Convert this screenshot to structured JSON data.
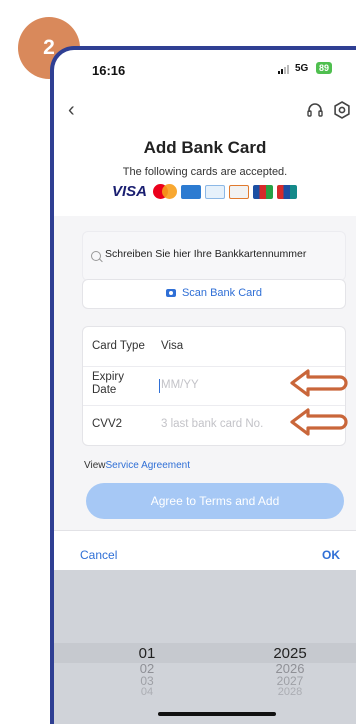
{
  "step": "2",
  "status_bar": {
    "time": "16:16",
    "network": "5G",
    "battery": "89"
  },
  "header": {
    "title": "Add Bank Card",
    "subtitle": "The following cards are accepted.",
    "visa": "VISA"
  },
  "icons": [
    "back-icon",
    "headset-icon",
    "gear-icon",
    "search-icon",
    "camera-icon"
  ],
  "form": {
    "card_number_placeholder": "Schreiben Sie hier Ihre Bankkartennummer",
    "scan_label": "Scan Bank Card",
    "card_type_label": "Card Type",
    "card_type_value": "Visa",
    "expiry_label": "Expiry Date",
    "expiry_placeholder": "MM/YY",
    "cvv_label": "CVV2",
    "cvv_placeholder": "3 last bank card No.",
    "agreement_prefix": "View",
    "agreement_link": "Service Agreement",
    "agree_button": "Agree to Terms and Add"
  },
  "picker": {
    "cancel": "Cancel",
    "ok": "OK",
    "months": [
      "01",
      "02",
      "03",
      "04"
    ],
    "years": [
      "2025",
      "2026",
      "2027",
      "2028"
    ]
  },
  "colors": {
    "accent": "#2f6fd6",
    "badge": "#d9895b",
    "frame": "#2f3f93",
    "arrow": "#c9663a"
  }
}
